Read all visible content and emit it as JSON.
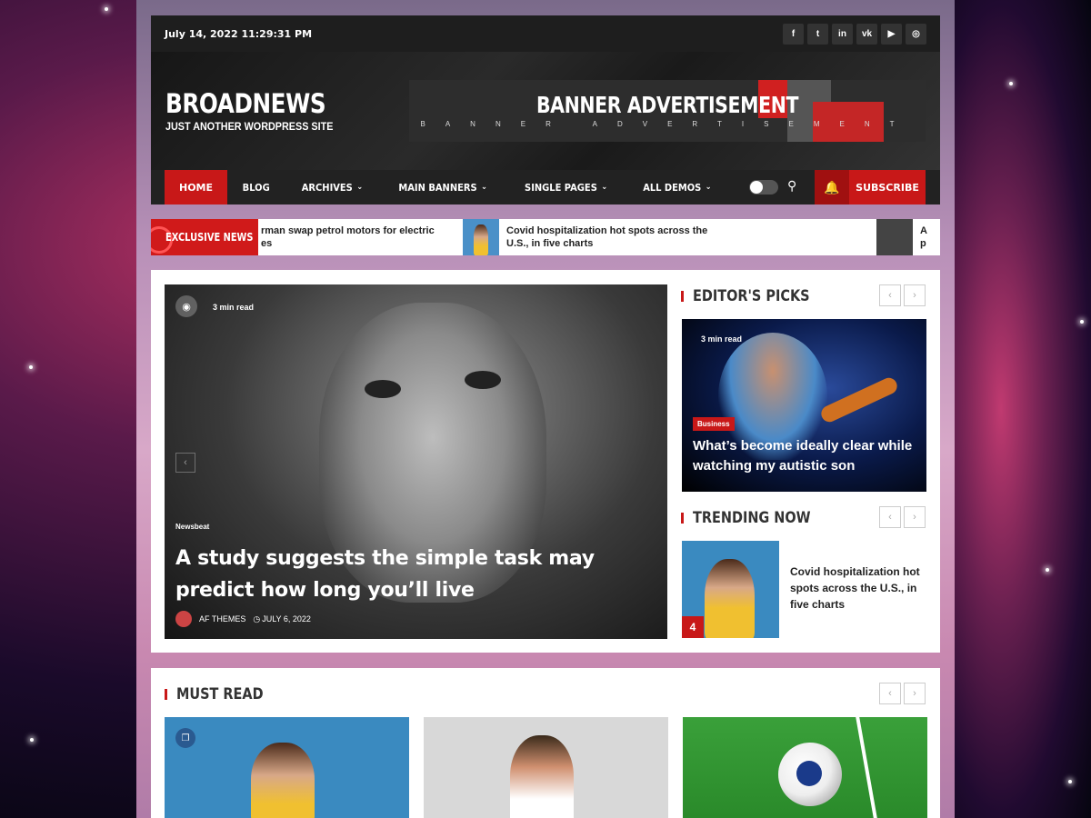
{
  "topbar": {
    "datetime": "July 14, 2022 11:29:31 PM",
    "socials": [
      "facebook-icon",
      "twitter-icon",
      "linkedin-icon",
      "vk-icon",
      "youtube-icon",
      "instagram-icon"
    ],
    "social_glyphs": [
      "f",
      "t",
      "in",
      "vk",
      "▶",
      "◎"
    ]
  },
  "header": {
    "site_name": "BROADNEWS",
    "tagline": "JUST ANOTHER WORDPRESS SITE",
    "banner_title": "BANNER ADVERTISEMENT",
    "banner_sub": "BANNER ADVERTISEMENT"
  },
  "nav": {
    "items": [
      {
        "label": "HOME",
        "active": true,
        "dropdown": false
      },
      {
        "label": "BLOG",
        "active": false,
        "dropdown": false
      },
      {
        "label": "ARCHIVES",
        "active": false,
        "dropdown": true
      },
      {
        "label": "MAIN BANNERS",
        "active": false,
        "dropdown": true
      },
      {
        "label": "SINGLE PAGES",
        "active": false,
        "dropdown": true
      },
      {
        "label": "ALL DEMOS",
        "active": false,
        "dropdown": true
      }
    ],
    "subscribe_label": "SUBSCRIBE"
  },
  "ticker": {
    "label": "EXCLUSIVE NEWS",
    "items": [
      {
        "text": "rman swap petrol motors for electric es",
        "line1": "rman swap petrol motors for electric",
        "line2": "es"
      },
      {
        "text": "Covid hospitalization hot spots across the U.S., in five charts",
        "line1": "Covid hospitalization hot spots across the",
        "line2": "U.S., in five charts"
      },
      {
        "line1": "A",
        "line2": "p"
      }
    ]
  },
  "hero": {
    "read_time": "3 min read",
    "category": "Newsbeat",
    "title": "A study suggests the simple task may predict how long you’ll live",
    "author": "AF THEMES",
    "date": "JULY 6, 2022"
  },
  "editors_picks": {
    "heading": "EDITOR'S PICKS",
    "read_time": "3 min read",
    "category": "Business",
    "title": "What’s become ideally clear while watching my autistic son"
  },
  "trending": {
    "heading": "TRENDING NOW",
    "number": "4",
    "title": "Covid hospitalization hot spots across the U.S., in five charts"
  },
  "must_read": {
    "heading": "MUST READ"
  },
  "colors": {
    "accent": "#c81818",
    "dark": "#1e1e1e"
  }
}
